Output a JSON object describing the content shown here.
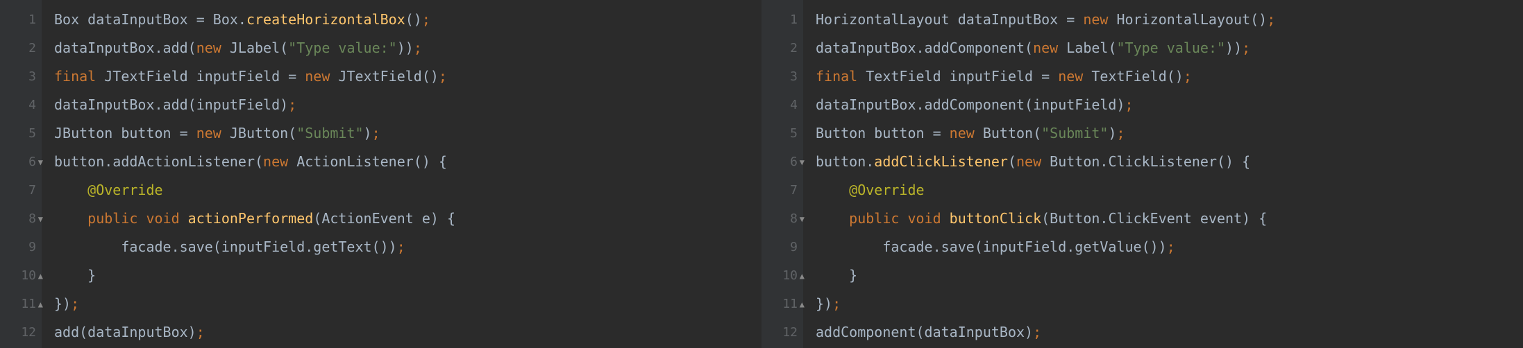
{
  "left": {
    "lines": [
      {
        "num": "1",
        "fold": "",
        "tokens": [
          {
            "t": "Box",
            "c": "type"
          },
          {
            "t": " dataInputBox ",
            "c": "ident"
          },
          {
            "t": "= ",
            "c": "ident"
          },
          {
            "t": "Box",
            "c": "type"
          },
          {
            "t": ".",
            "c": "ident"
          },
          {
            "t": "createHorizontalBox",
            "c": "method"
          },
          {
            "t": "()",
            "c": "paren"
          },
          {
            "t": ";",
            "c": "punct"
          }
        ]
      },
      {
        "num": "2",
        "fold": "",
        "tokens": [
          {
            "t": "dataInputBox.add(",
            "c": "ident"
          },
          {
            "t": "new ",
            "c": "keyword"
          },
          {
            "t": "JLabel(",
            "c": "type"
          },
          {
            "t": "\"Type value:\"",
            "c": "string"
          },
          {
            "t": "))",
            "c": "paren"
          },
          {
            "t": ";",
            "c": "punct"
          }
        ]
      },
      {
        "num": "3",
        "fold": "",
        "tokens": [
          {
            "t": "final ",
            "c": "keyword"
          },
          {
            "t": "JTextField inputField = ",
            "c": "ident"
          },
          {
            "t": "new ",
            "c": "keyword"
          },
          {
            "t": "JTextField()",
            "c": "type"
          },
          {
            "t": ";",
            "c": "punct"
          }
        ]
      },
      {
        "num": "4",
        "fold": "",
        "tokens": [
          {
            "t": "dataInputBox.add(inputField)",
            "c": "ident"
          },
          {
            "t": ";",
            "c": "punct"
          }
        ]
      },
      {
        "num": "5",
        "fold": "",
        "tokens": [
          {
            "t": "JButton button = ",
            "c": "ident"
          },
          {
            "t": "new ",
            "c": "keyword"
          },
          {
            "t": "JButton(",
            "c": "type"
          },
          {
            "t": "\"Submit\"",
            "c": "string"
          },
          {
            "t": ")",
            "c": "paren"
          },
          {
            "t": ";",
            "c": "punct"
          }
        ]
      },
      {
        "num": "6",
        "fold": "▼",
        "tokens": [
          {
            "t": "button.addActionListener(",
            "c": "ident"
          },
          {
            "t": "new ",
            "c": "keyword"
          },
          {
            "t": "ActionListener() {",
            "c": "type"
          }
        ]
      },
      {
        "num": "7",
        "fold": "",
        "indent": 1,
        "tokens": [
          {
            "t": "@Override",
            "c": "annotation"
          }
        ]
      },
      {
        "num": "8",
        "fold": "▼",
        "indent": 1,
        "tokens": [
          {
            "t": "public void ",
            "c": "keyword"
          },
          {
            "t": "actionPerformed",
            "c": "special-method"
          },
          {
            "t": "(ActionEvent e) {",
            "c": "ident"
          }
        ]
      },
      {
        "num": "9",
        "fold": "",
        "indent": 2,
        "tokens": [
          {
            "t": "facade.save(inputField.getText())",
            "c": "ident"
          },
          {
            "t": ";",
            "c": "punct"
          }
        ]
      },
      {
        "num": "10",
        "fold": "▲",
        "indent": 1,
        "tokens": [
          {
            "t": "}",
            "c": "ident"
          }
        ]
      },
      {
        "num": "11",
        "fold": "▲",
        "tokens": [
          {
            "t": "})",
            "c": "ident"
          },
          {
            "t": ";",
            "c": "punct"
          }
        ]
      },
      {
        "num": "12",
        "fold": "",
        "tokens": [
          {
            "t": "add(dataInputBox)",
            "c": "ident"
          },
          {
            "t": ";",
            "c": "punct"
          }
        ]
      }
    ]
  },
  "right": {
    "lines": [
      {
        "num": "1",
        "fold": "",
        "tokens": [
          {
            "t": "HorizontalLayout dataInputBox = ",
            "c": "ident"
          },
          {
            "t": "new ",
            "c": "keyword"
          },
          {
            "t": "HorizontalLayout()",
            "c": "type"
          },
          {
            "t": ";",
            "c": "punct"
          }
        ]
      },
      {
        "num": "2",
        "fold": "",
        "tokens": [
          {
            "t": "dataInputBox.addComponent(",
            "c": "ident"
          },
          {
            "t": "new ",
            "c": "keyword"
          },
          {
            "t": "Label(",
            "c": "type"
          },
          {
            "t": "\"Type value:\"",
            "c": "string"
          },
          {
            "t": "))",
            "c": "paren"
          },
          {
            "t": ";",
            "c": "punct"
          }
        ]
      },
      {
        "num": "3",
        "fold": "",
        "tokens": [
          {
            "t": "final ",
            "c": "keyword"
          },
          {
            "t": "TextField inputField = ",
            "c": "ident"
          },
          {
            "t": "new ",
            "c": "keyword"
          },
          {
            "t": "TextField()",
            "c": "type"
          },
          {
            "t": ";",
            "c": "punct"
          }
        ]
      },
      {
        "num": "4",
        "fold": "",
        "tokens": [
          {
            "t": "dataInputBox.addComponent(inputField)",
            "c": "ident"
          },
          {
            "t": ";",
            "c": "punct"
          }
        ]
      },
      {
        "num": "5",
        "fold": "",
        "tokens": [
          {
            "t": "Button button = ",
            "c": "ident"
          },
          {
            "t": "new ",
            "c": "keyword"
          },
          {
            "t": "Button(",
            "c": "type"
          },
          {
            "t": "\"Submit\"",
            "c": "string"
          },
          {
            "t": ")",
            "c": "paren"
          },
          {
            "t": ";",
            "c": "punct"
          }
        ]
      },
      {
        "num": "6",
        "fold": "▼",
        "tokens": [
          {
            "t": "button.",
            "c": "ident"
          },
          {
            "t": "addClickListener",
            "c": "special-method"
          },
          {
            "t": "(",
            "c": "ident"
          },
          {
            "t": "new ",
            "c": "keyword"
          },
          {
            "t": "Button.ClickListener() {",
            "c": "type"
          }
        ]
      },
      {
        "num": "7",
        "fold": "",
        "indent": 1,
        "tokens": [
          {
            "t": "@Override",
            "c": "annotation"
          }
        ]
      },
      {
        "num": "8",
        "fold": "▼",
        "indent": 1,
        "tokens": [
          {
            "t": "public void ",
            "c": "keyword"
          },
          {
            "t": "buttonClick",
            "c": "special-method"
          },
          {
            "t": "(Button.ClickEvent event) {",
            "c": "ident"
          }
        ]
      },
      {
        "num": "9",
        "fold": "",
        "indent": 2,
        "tokens": [
          {
            "t": "facade.save(inputField.getValue())",
            "c": "ident"
          },
          {
            "t": ";",
            "c": "punct"
          }
        ]
      },
      {
        "num": "10",
        "fold": "▲",
        "indent": 1,
        "tokens": [
          {
            "t": "}",
            "c": "ident"
          }
        ]
      },
      {
        "num": "11",
        "fold": "▲",
        "tokens": [
          {
            "t": "})",
            "c": "ident"
          },
          {
            "t": ";",
            "c": "punct"
          }
        ]
      },
      {
        "num": "12",
        "fold": "",
        "tokens": [
          {
            "t": "addComponent(dataInputBox)",
            "c": "ident"
          },
          {
            "t": ";",
            "c": "punct"
          }
        ]
      }
    ]
  }
}
